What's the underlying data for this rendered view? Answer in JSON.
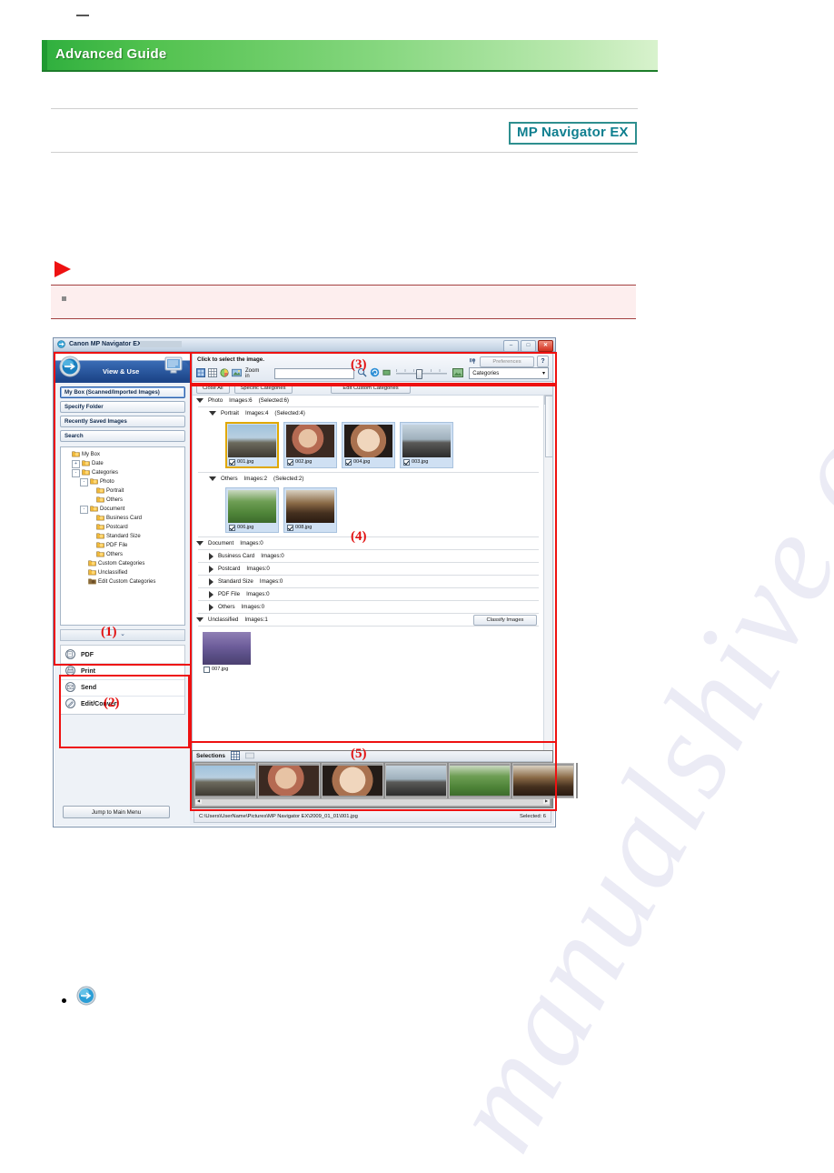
{
  "page": {
    "banner_title": "Advanced Guide",
    "product_badge": "MP Navigator EX"
  },
  "window": {
    "title": "Canon MP Navigator EX",
    "buttons": {
      "minimize": "–",
      "maximize": "□",
      "close": "✕"
    }
  },
  "sidebar": {
    "mode_label": "View & Use",
    "nav_buttons": [
      {
        "label": "My Box (Scanned/Imported Images)",
        "selected": true
      },
      {
        "label": "Specify Folder",
        "selected": false
      },
      {
        "label": "Recently Saved Images",
        "selected": false
      },
      {
        "label": "Search",
        "selected": false
      }
    ],
    "tree": [
      {
        "label": "My Box",
        "indent": 0,
        "expander": ""
      },
      {
        "label": "Date",
        "indent": 1,
        "expander": "+"
      },
      {
        "label": "Categories",
        "indent": 1,
        "expander": "-"
      },
      {
        "label": "Photo",
        "indent": 2,
        "expander": "-"
      },
      {
        "label": "Portrait",
        "indent": 3,
        "expander": ""
      },
      {
        "label": "Others",
        "indent": 3,
        "expander": ""
      },
      {
        "label": "Document",
        "indent": 2,
        "expander": "-"
      },
      {
        "label": "Business Card",
        "indent": 3,
        "expander": ""
      },
      {
        "label": "Postcard",
        "indent": 3,
        "expander": ""
      },
      {
        "label": "Standard Size",
        "indent": 3,
        "expander": ""
      },
      {
        "label": "PDF File",
        "indent": 3,
        "expander": ""
      },
      {
        "label": "Others",
        "indent": 3,
        "expander": ""
      },
      {
        "label": "Custom Categories",
        "indent": 2,
        "expander": ""
      },
      {
        "label": "Unclassified",
        "indent": 2,
        "expander": ""
      },
      {
        "label": "Edit Custom Categories",
        "indent": 2,
        "expander": ""
      }
    ],
    "collapse_glyph": "⌄",
    "actions": [
      {
        "label": "PDF",
        "icon": "pdf-icon"
      },
      {
        "label": "Print",
        "icon": "print-icon"
      },
      {
        "label": "Send",
        "icon": "send-icon"
      },
      {
        "label": "Edit/Convert",
        "icon": "edit-convert-icon"
      }
    ],
    "jump_button": "Jump to Main Menu"
  },
  "toolbar": {
    "hint": "Click to select the image.",
    "preferences": "Preferences",
    "help": "?",
    "zoom_in": "Zoom in",
    "search_value": "",
    "category_select": "Categories",
    "dropdown_glyph": "▾"
  },
  "list": {
    "close_all": "Close All",
    "specific_categories": "Specific Categories",
    "edit_custom_categories": "Edit Custom Categories",
    "classify_images": "Classify Images",
    "groups": [
      {
        "name": "Photo",
        "count": "Images:6",
        "selected": "(Selected:6)",
        "open": true,
        "level": 0,
        "subgroups": [
          {
            "name": "Portrait",
            "count": "Images:4",
            "selected": "(Selected:4)",
            "open": true,
            "items": [
              {
                "file": "001.jpg",
                "checked": true,
                "highlight": true
              },
              {
                "file": "002.jpg",
                "checked": true,
                "highlight": false
              },
              {
                "file": "004.jpg",
                "checked": true,
                "highlight": false
              },
              {
                "file": "003.jpg",
                "checked": true,
                "highlight": false
              }
            ]
          },
          {
            "name": "Others",
            "count": "Images:2",
            "selected": "(Selected:2)",
            "open": true,
            "items": [
              {
                "file": "006.jpg",
                "checked": true,
                "highlight": false
              },
              {
                "file": "008.jpg",
                "checked": true,
                "highlight": false
              }
            ]
          }
        ]
      },
      {
        "name": "Document",
        "count": "Images:0",
        "selected": "",
        "open": true,
        "level": 0,
        "subgroups": [
          {
            "name": "Business Card",
            "count": "Images:0",
            "selected": "",
            "open": false,
            "items": []
          },
          {
            "name": "Postcard",
            "count": "Images:0",
            "selected": "",
            "open": false,
            "items": []
          },
          {
            "name": "Standard Size",
            "count": "Images:0",
            "selected": "",
            "open": false,
            "items": []
          },
          {
            "name": "PDF File",
            "count": "Images:0",
            "selected": "",
            "open": false,
            "items": []
          },
          {
            "name": "Others",
            "count": "Images:0",
            "selected": "",
            "open": false,
            "items": []
          }
        ]
      },
      {
        "name": "Unclassified",
        "count": "Images:1",
        "selected": "",
        "open": true,
        "level": 0,
        "has_classify": true,
        "subgroups": [
          {
            "name": "",
            "count": "",
            "selected": "",
            "open": true,
            "flat": true,
            "items": [
              {
                "file": "007.jpg",
                "checked": false,
                "highlight": false
              }
            ]
          }
        ]
      }
    ]
  },
  "selections": {
    "title": "Selections",
    "thumbnails": [
      "001.jpg",
      "002.jpg",
      "004.jpg",
      "003.jpg",
      "006.jpg",
      "008.jpg"
    ]
  },
  "statusbar": {
    "path": "C:\\Users\\UserName\\Pictures\\MP Navigator EX\\2009_01_01\\001.jpg",
    "selected": "Selected: 6"
  },
  "annotations": {
    "a1": "(1)",
    "a2": "(2)",
    "a3": "(3)",
    "a4": "(4)",
    "a5": "(5)"
  },
  "watermark": "manualshive.com"
}
